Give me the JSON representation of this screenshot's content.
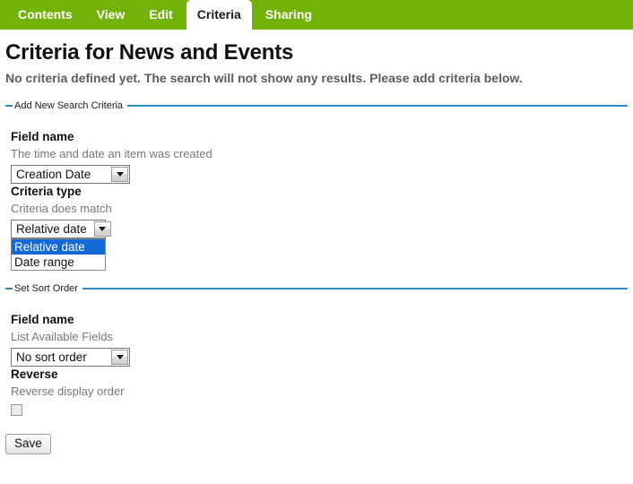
{
  "theme": {
    "tabbar_green": "#73b208",
    "legend_blue": "#3189c8",
    "highlight_blue": "#1569d6",
    "help_gray": "#787878",
    "desc_gray": "#5c5c5c"
  },
  "tabs": [
    {
      "label": "Contents",
      "active": false
    },
    {
      "label": "View",
      "active": false
    },
    {
      "label": "Edit",
      "active": false
    },
    {
      "label": "Criteria",
      "active": true
    },
    {
      "label": "Sharing",
      "active": false
    }
  ],
  "page": {
    "title": "Criteria for News and Events",
    "description": "No criteria defined yet. The search will not show any results. Please add criteria below."
  },
  "add_criteria": {
    "legend": "Add New Search Criteria",
    "field_name": {
      "label": "Field name",
      "help": "The time and date an item was created",
      "value": "Creation Date"
    },
    "criteria_type": {
      "label": "Criteria type",
      "help": "Criteria does match",
      "value": "Relative date",
      "open": true,
      "options": [
        {
          "label": "Relative date",
          "selected": true
        },
        {
          "label": "Date range",
          "selected": false
        }
      ]
    }
  },
  "sort_order": {
    "legend": "Set Sort Order",
    "field_name": {
      "label": "Field name",
      "help": "List Available Fields",
      "value": "No sort order"
    },
    "reverse": {
      "label": "Reverse",
      "help": "Reverse display order",
      "checked": false
    }
  },
  "actions": {
    "save_label": "Save"
  }
}
